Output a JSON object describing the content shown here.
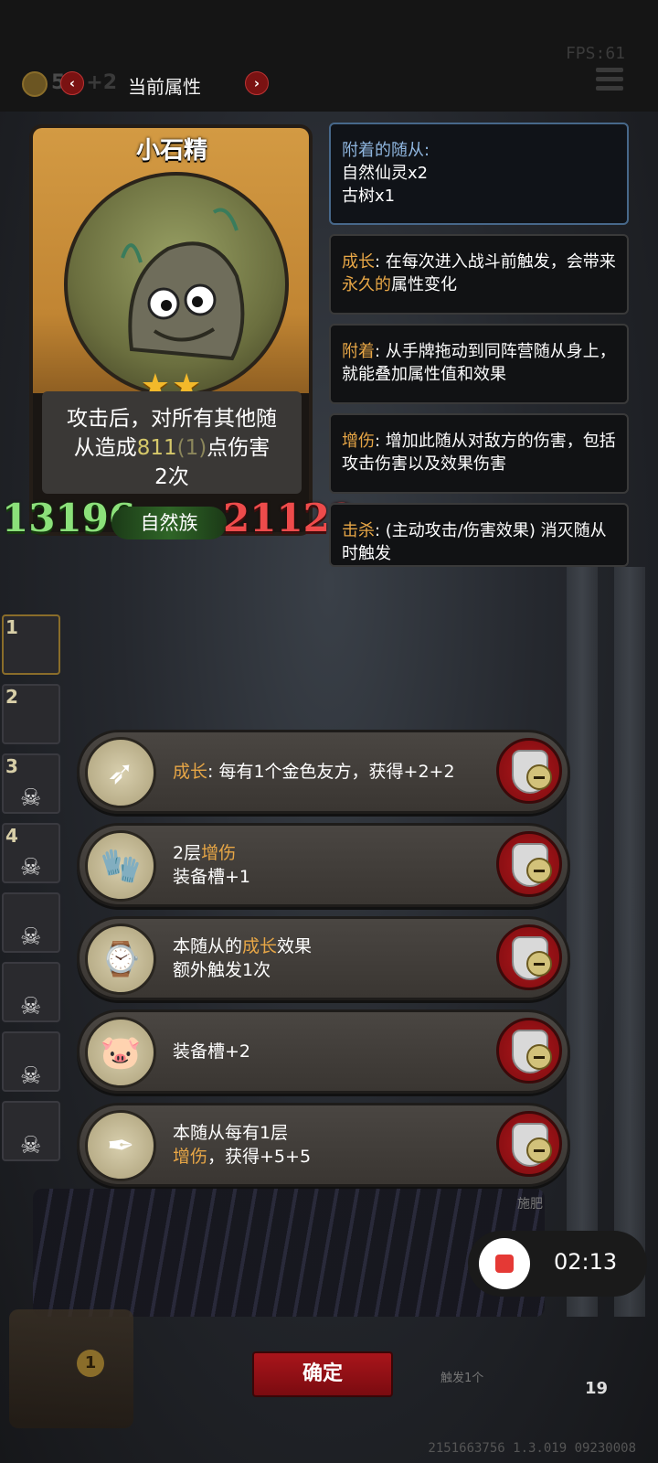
{
  "header": {
    "fps": "FPS:61",
    "gold": "5",
    "gold_hidden": "7 +2",
    "title": "当前属性",
    "prev_icon": "‹",
    "next_icon": "›"
  },
  "card": {
    "name": "小石精",
    "stars": "★★",
    "desc_line1": "攻击后，对所有其他随",
    "desc_pre": "从造成",
    "desc_damage": "811",
    "desc_damage2": "(1)",
    "desc_post": "点伤害",
    "desc_line3": "2次",
    "attack": "13196",
    "health": "21122",
    "tribe": "自然族"
  },
  "info_panels": [
    {
      "title": "附着的随从:",
      "lines": [
        "自然仙灵x2",
        "古树x1"
      ]
    },
    {
      "key": "成长",
      "text": ": 在每次进入战斗前触发，会带来",
      "highlight": "永久的",
      "rest": "属性变化"
    },
    {
      "key": "附着",
      "text": ": 从手牌拖动到同阵营随从身上，就能叠加属性值和效果"
    },
    {
      "key": "增伤",
      "text": ": 增加此随从对敌方的伤害，包括攻击伤害以及效果伤害"
    },
    {
      "key": "击杀",
      "text": ": (主动攻击/伤害效果) 消灭随从时触发"
    }
  ],
  "roster": [
    "1",
    "2",
    "3",
    "4"
  ],
  "equipment": [
    {
      "icon": "➶",
      "key": "成长",
      "line1": ": 每有1个金色友方，获得+2+2",
      "line2": ""
    },
    {
      "icon": "🧤",
      "pre": "2层",
      "key": "增伤",
      "line2": "装备槽+1"
    },
    {
      "icon": "⌚",
      "pre": "本随从的",
      "key": "成长",
      "post": "效果",
      "line2": "额外触发1次"
    },
    {
      "icon": "🐷",
      "line1": "装备槽+2"
    },
    {
      "icon": "✒",
      "line1": "本随从每有1层",
      "key": "增伤",
      "post": "，获得+5+5"
    }
  ],
  "footer": {
    "confirm": "确定",
    "rec_time": "02:13",
    "chest_count": "1",
    "trigger": "触发1个",
    "fertilize": "施肥",
    "hero_count": "19",
    "build": "2151663756 1.3.019 09230008"
  }
}
